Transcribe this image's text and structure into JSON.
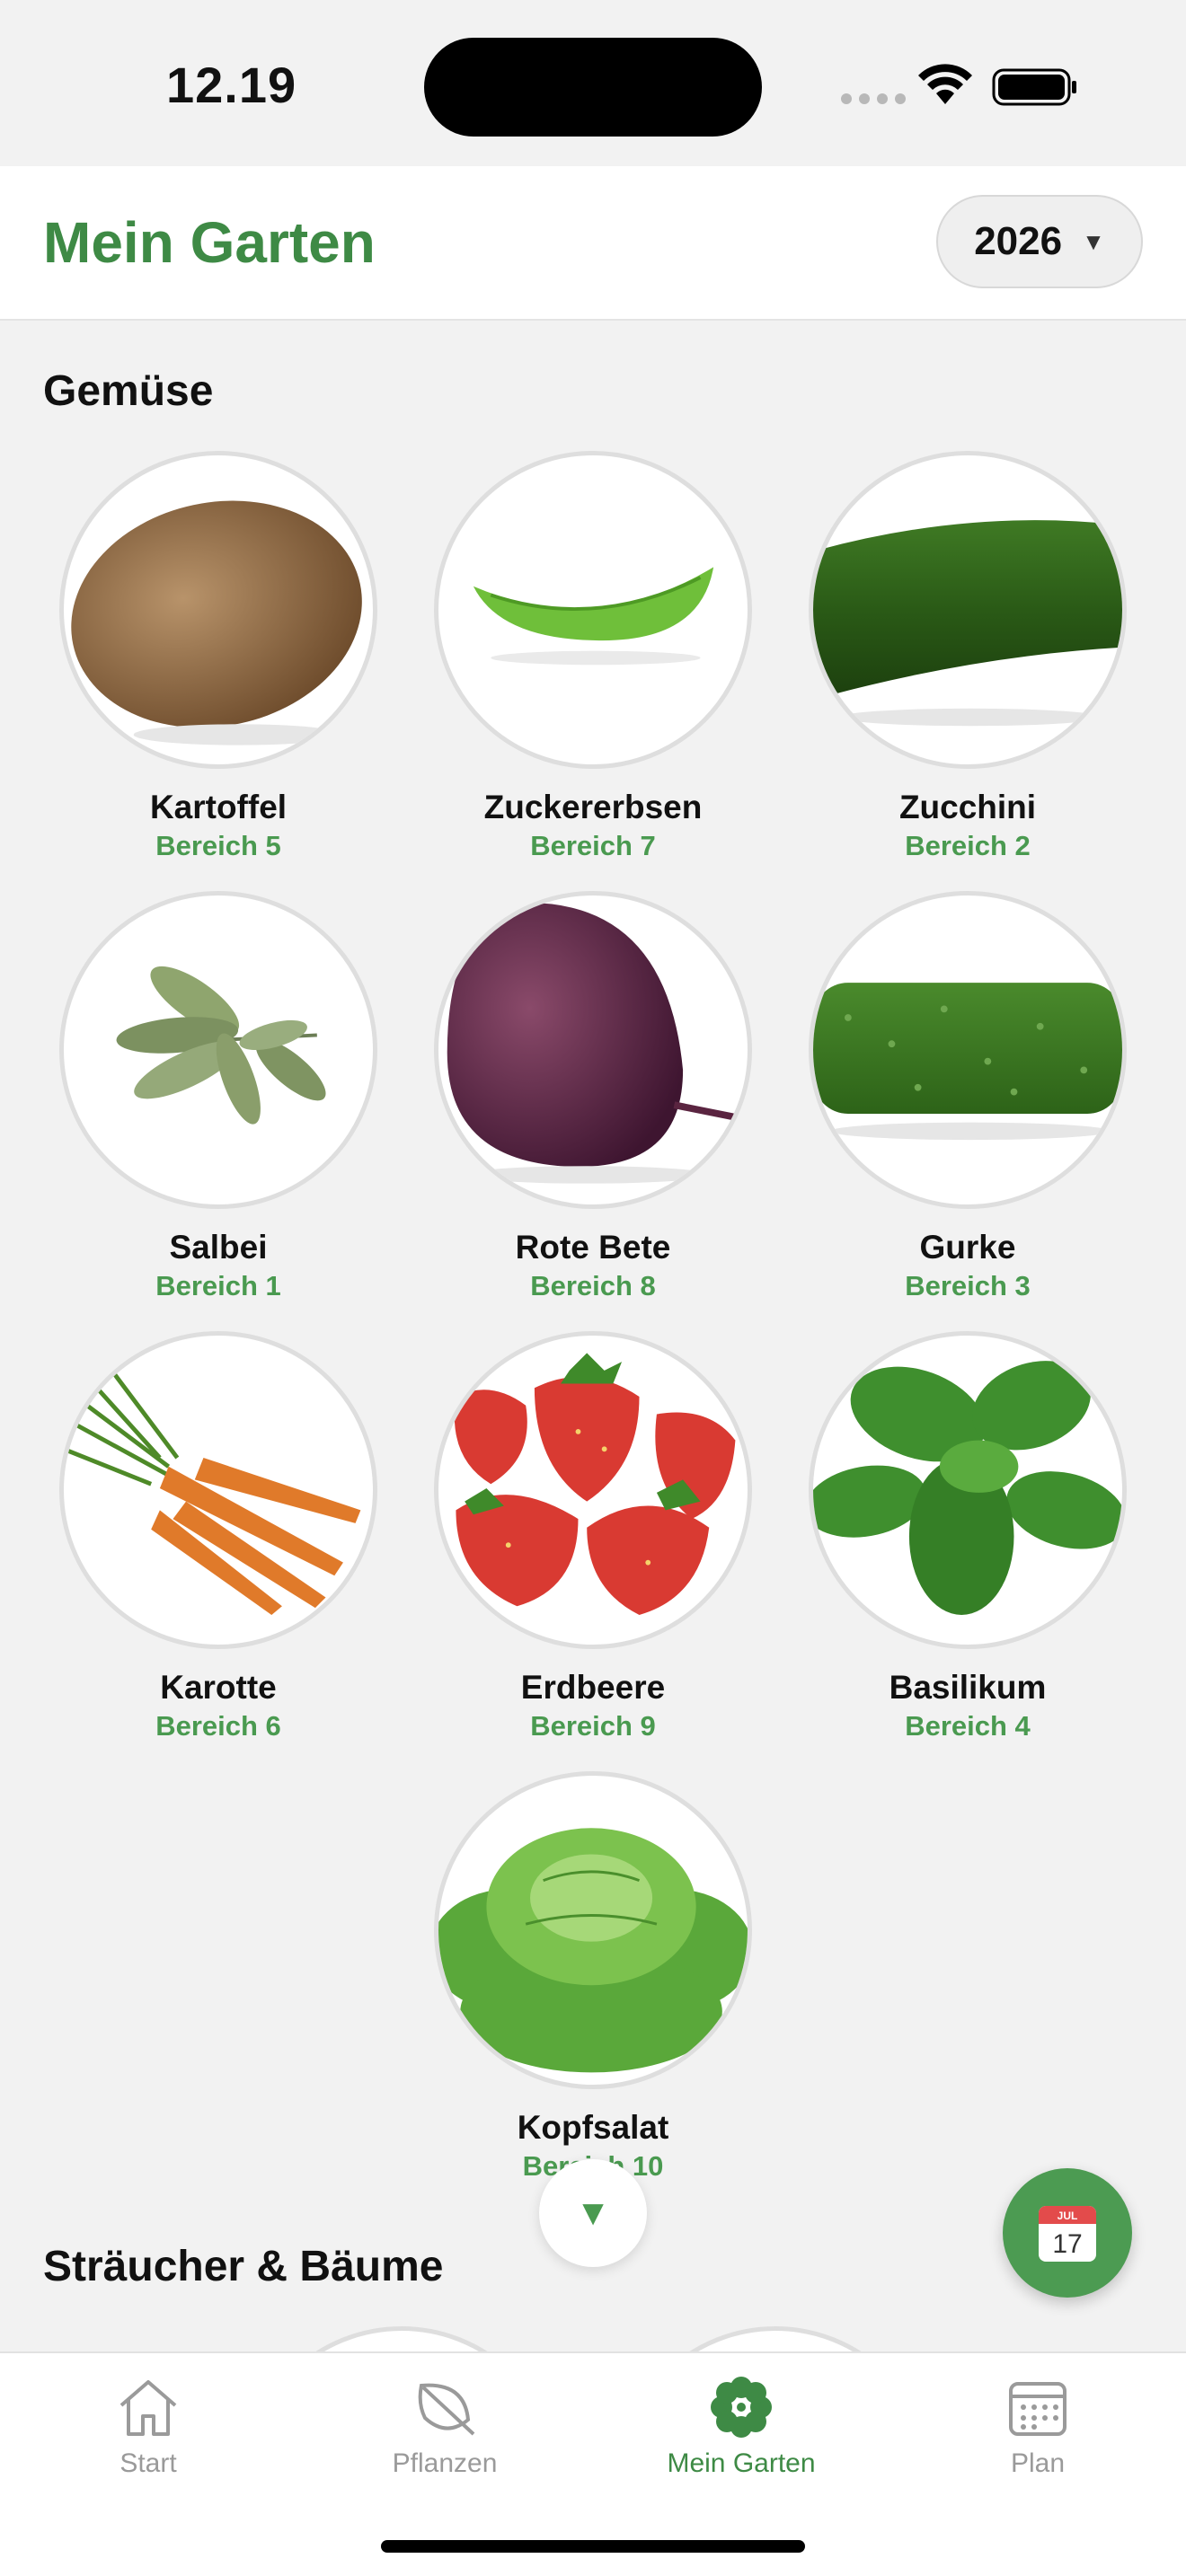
{
  "status_bar": {
    "time": "12.19"
  },
  "header": {
    "title": "Mein Garten",
    "year": "2026"
  },
  "sections": {
    "vegetables_title": "Gemüse",
    "shrubs_title": "Sträucher & Bäume"
  },
  "vegetables": [
    {
      "name": "Kartoffel",
      "area": "Bereich 5",
      "image": "potato"
    },
    {
      "name": "Zuckererbsen",
      "area": "Bereich 7",
      "image": "snow-pea"
    },
    {
      "name": "Zucchini",
      "area": "Bereich 2",
      "image": "zucchini"
    },
    {
      "name": "Salbei",
      "area": "Bereich 1",
      "image": "sage"
    },
    {
      "name": "Rote Bete",
      "area": "Bereich 8",
      "image": "beetroot"
    },
    {
      "name": "Gurke",
      "area": "Bereich 3",
      "image": "cucumber"
    },
    {
      "name": "Karotte",
      "area": "Bereich 6",
      "image": "carrot"
    },
    {
      "name": "Erdbeere",
      "area": "Bereich 9",
      "image": "strawberry"
    },
    {
      "name": "Basilikum",
      "area": "Bereich 4",
      "image": "basil"
    },
    {
      "name": "Kopfsalat",
      "area": "Bereich 10",
      "image": "lettuce"
    }
  ],
  "fab": {
    "calendar_month": "JUL",
    "calendar_day": "17"
  },
  "tabs": [
    {
      "label": "Start",
      "icon": "house-icon",
      "active": false
    },
    {
      "label": "Pflanzen",
      "icon": "leaf-icon",
      "active": false
    },
    {
      "label": "Mein Garten",
      "icon": "flower-icon",
      "active": true
    },
    {
      "label": "Plan",
      "icon": "calendar-icon",
      "active": false
    }
  ],
  "colors": {
    "accent": "#3e8a45",
    "area_text": "#4a9a50",
    "background": "#f2f2f2"
  }
}
